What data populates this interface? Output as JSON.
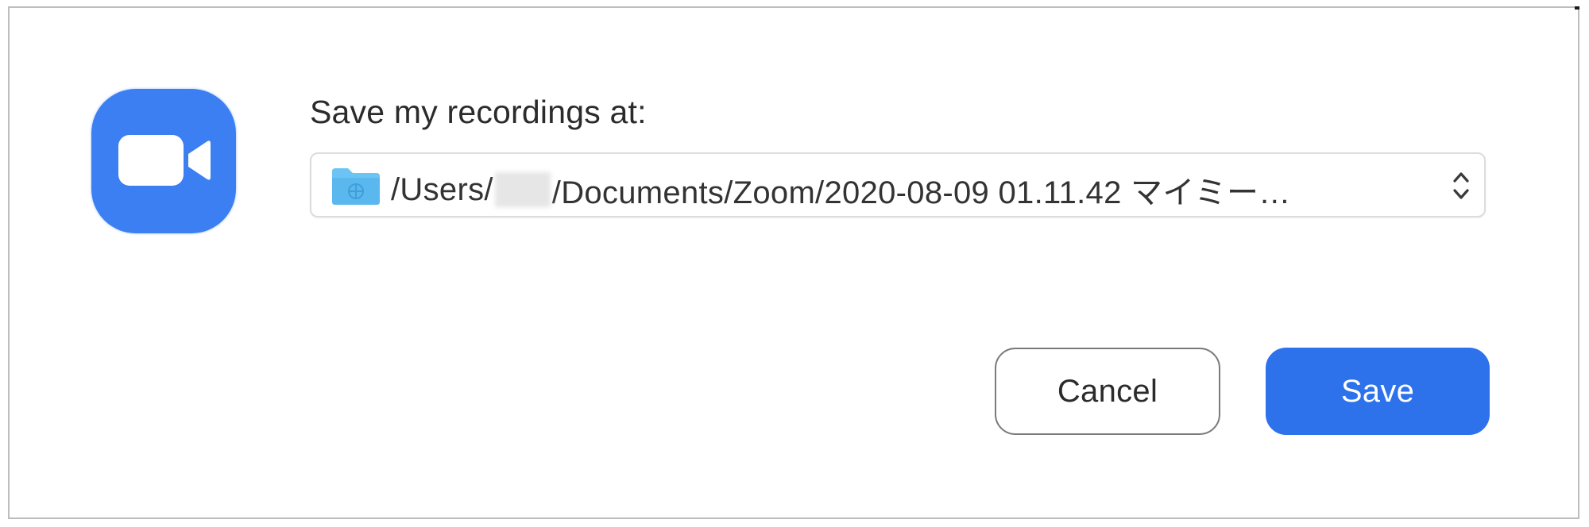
{
  "dialog": {
    "prompt": "Save my recordings at:",
    "path": {
      "prefix": "/Users/",
      "suffix": "/Documents/Zoom/2020-08-09 01.11.42 マイミー…"
    },
    "buttons": {
      "cancel": "Cancel",
      "save": "Save"
    },
    "icons": {
      "app": "zoom-camera-icon",
      "folder": "folder-icon",
      "stepper": "chevron-up-down-icon"
    },
    "colors": {
      "accent": "#2d72ea",
      "app_icon": "#3b7ff2",
      "folder": "#6cc4f5"
    }
  }
}
